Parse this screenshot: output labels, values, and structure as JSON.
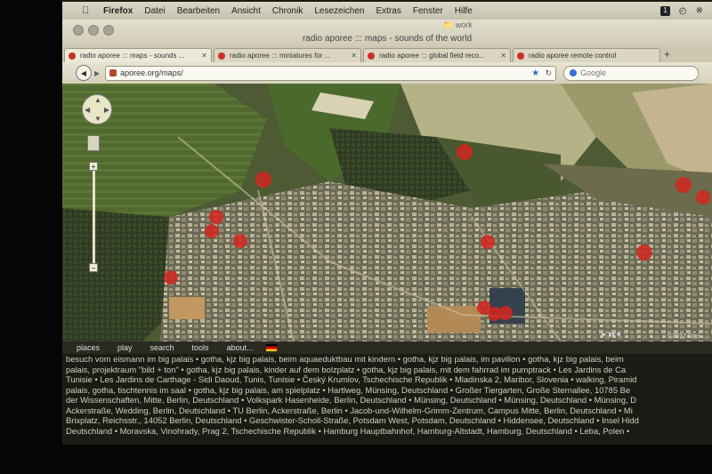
{
  "menubar": {
    "items": [
      "Firefox",
      "Datei",
      "Bearbeiten",
      "Ansicht",
      "Chronik",
      "Lesezeichen",
      "Extras",
      "Fenster",
      "Hilfe"
    ],
    "badge": "1"
  },
  "window": {
    "folder_label": "work",
    "title": "radio aporee ::: maps - sounds of the world"
  },
  "tabs": [
    {
      "label": "radio aporee ::: maps - sounds ..."
    },
    {
      "label": "radio aporee ::: miniatures for ..."
    },
    {
      "label": "radio aporee ::: global field reco..."
    },
    {
      "label": "radio aporee remote control"
    }
  ],
  "navbar": {
    "url": "aporee.org/maps/",
    "search_placeholder": "Google"
  },
  "map": {
    "marker_color": "#d2261f",
    "copyright": "©2012 Goo..."
  },
  "panel_nav": {
    "items": [
      "places",
      "play",
      "search",
      "tools",
      "about..."
    ]
  },
  "places_lines": [
    "besuch vom eismann im big palais • gotha, kjz big palais, beim aquaeduktbau mit kindern • gotha, kjz big palais, im pavillon • gotha, kjz big palais, beim",
    "palais, projektraum \"bild + ton\" • gotha, kjz big palais, kinder auf dem bolzplatz • gotha, kjz big palais, mit dem fahrrad im pumptrack • Les Jardins de Ca",
    "Tunisie • Les Jardins de Carthage - Sidi Daoud, Tunis, Tunisie • Český Krumlov, Tschechische Republik • Mladinska 2, Maribor, Slovenia • walking, Piramid",
    "palais, gotha, tischtennis im saal • gotha, kjz big palais, am spielplatz • Hartlweg, Münsing, Deutschland • Großer Tiergarten, Große Sternallee, 10785 Be",
    "der Wissenschaften, Mitte, Berlin, Deutschland • Volkspark Hasenheide, Berlin, Deutschland • Münsing, Deutschland • Münsing, Deutschland • Münsing, D",
    "Ackerstraße, Wedding, Berlin, Deutschland • TU Berlin, Ackerstraße, Berlin • Jacob-und-Wilhelm-Grimm-Zentrum, Campus Mitte, Berlin, Deutschland • Mi",
    "Brixplatz, Reichsstr., 14052 Berlin, Deutschland • Geschwister-Scholl-Straße, Potsdam West, Potsdam, Deutschland • Hiddensee, Deutschland • Insel Hidd",
    "Deutschland • Moravska, Vinohrady, Prag 2, Tschechische Republik • Hamburg Hauptbahnhof, Hamburg-Altstadt, Hamburg, Deutschland • Leba, Polen •"
  ]
}
